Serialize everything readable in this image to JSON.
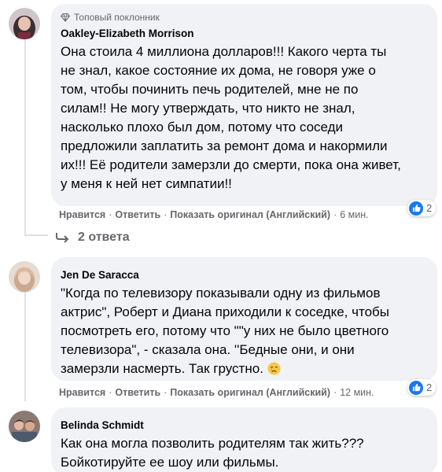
{
  "comments": [
    {
      "badge": "Топовый поклонник",
      "author": "Oakley-Elizabeth Morrison",
      "text": "Она стоила 4 миллиона долларов!!! Какого черта ты\nне знал, какое состояние их дома, не говоря уже о\nтом, чтобы починить печь родителей, мне не по\nсилам!! Не могу утверждать, что никто не знал,\nнасколько плохо был дом, потому что соседи\nпредложили заплатить за ремонт дома и накормили\nих!!! Её родители замерзли до смерти, пока она живет,\nу меня к ней нет симпатии!!",
      "reactions_count": "2",
      "actions": {
        "like": "Нравится",
        "reply": "Ответить",
        "see_original": "Показать оригинал (Английский)",
        "time": "6 мин."
      }
    },
    {
      "author": "Jen De Saracca",
      "text": "\"Когда по телевизору показывали одну из фильмов\nактрис\", Роберт и Диана приходили к соседке, чтобы\nпосмотреть его, потому что \"\"у них не было цветного\nтелевизора\", - сказала она. ''Бедные они, и они\nзамерзли насмерть. Так грустно. ",
      "reactions_count": "2",
      "actions": {
        "like": "Нравится",
        "reply": "Ответить",
        "see_original": "Показать оригинал (Английский)",
        "time": "12 мин."
      }
    },
    {
      "author": "Belinda Schmidt",
      "text": "Как она могла позволить родителям так жить???\nБойкотируйте ее шоу или фильмы."
    }
  ],
  "replies_label": "2 ответа",
  "sep": "·",
  "icons": {
    "badge": "diamond-badge-icon",
    "reply_arrow": "reply-arrow-icon",
    "like": "like-reaction-icon",
    "emoji": "crying-face-emoji-icon"
  },
  "colors": {
    "bubble": "#f0f2f5",
    "like_blue": "#1877f2",
    "meta_gray": "#65676b"
  }
}
